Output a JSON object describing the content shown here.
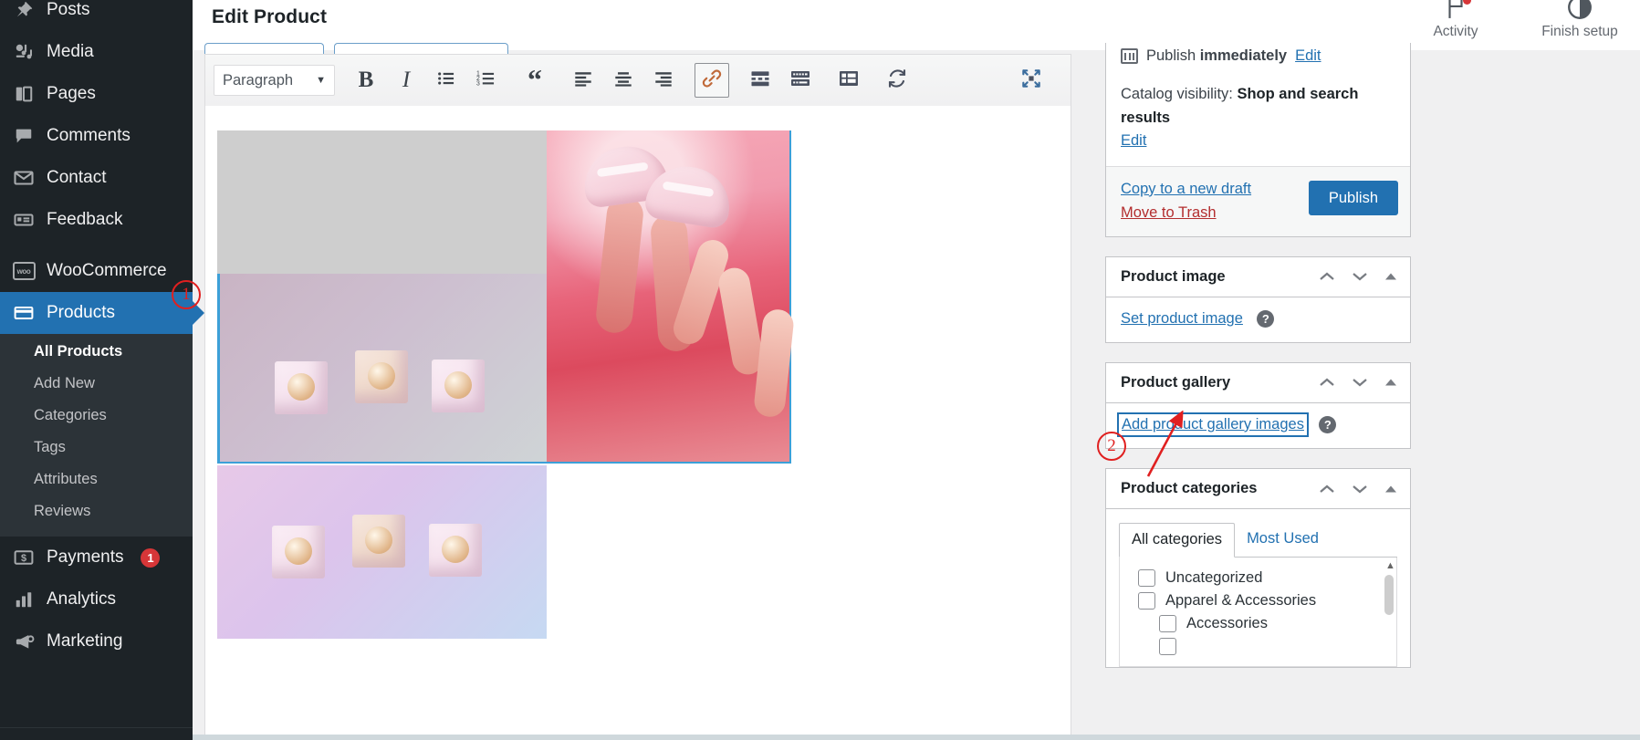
{
  "sidebar": {
    "items": [
      {
        "label": "Posts",
        "icon": "pin-icon",
        "active": false
      },
      {
        "label": "Media",
        "icon": "media-icon",
        "active": false
      },
      {
        "label": "Pages",
        "icon": "pages-icon",
        "active": false
      },
      {
        "label": "Comments",
        "icon": "comment-icon",
        "active": false
      },
      {
        "label": "Contact",
        "icon": "envelope-icon",
        "active": false
      },
      {
        "label": "Feedback",
        "icon": "feedback-icon",
        "active": false
      },
      {
        "label": "WooCommerce",
        "icon": "woo-icon",
        "active": false
      },
      {
        "label": "Products",
        "icon": "products-icon",
        "active": true
      },
      {
        "label": "Payments",
        "icon": "payments-icon",
        "active": false,
        "badge": "1"
      },
      {
        "label": "Analytics",
        "icon": "analytics-icon",
        "active": false
      },
      {
        "label": "Marketing",
        "icon": "megaphone-icon",
        "active": false
      }
    ],
    "submenu": [
      {
        "label": "All Products",
        "current": true
      },
      {
        "label": "Add New",
        "current": false
      },
      {
        "label": "Categories",
        "current": false
      },
      {
        "label": "Tags",
        "current": false
      },
      {
        "label": "Attributes",
        "current": false
      },
      {
        "label": "Reviews",
        "current": false
      }
    ]
  },
  "header": {
    "title": "Edit Product",
    "actions": [
      {
        "label": "Activity",
        "icon": "flag-icon",
        "has_dot": true
      },
      {
        "label": "Finish setup",
        "icon": "progress-circle-icon",
        "has_dot": false
      }
    ]
  },
  "editor": {
    "format_select": {
      "value": "Paragraph",
      "caret": "▼"
    },
    "buttons": [
      {
        "name": "bold-button",
        "label": "B",
        "active": false
      },
      {
        "name": "italic-button",
        "label": "I",
        "active": false
      },
      {
        "name": "bulleted-list-button",
        "label": "Bulleted list",
        "active": false
      },
      {
        "name": "numbered-list-button",
        "label": "Numbered list",
        "active": false
      },
      {
        "name": "blockquote-button",
        "label": "Blockquote",
        "active": false
      },
      {
        "name": "align-left-button",
        "label": "Align left",
        "active": false
      },
      {
        "name": "align-center-button",
        "label": "Align center",
        "active": false
      },
      {
        "name": "align-right-button",
        "label": "Align right",
        "active": false
      },
      {
        "name": "insert-link-button",
        "label": "Insert/edit link",
        "active": true
      },
      {
        "name": "read-more-button",
        "label": "Insert Read More tag",
        "active": false
      },
      {
        "name": "keyboard-shortcuts-button",
        "label": "Keyboard shortcuts",
        "active": false
      },
      {
        "name": "toolbar-toggle-button",
        "label": "Toolbar toggle",
        "active": false
      },
      {
        "name": "undo-redo-button",
        "label": "Redo",
        "active": false
      }
    ],
    "fullscreen_label": "Distraction-free writing mode"
  },
  "publish_box": {
    "schedule_text_prefix": "Publish ",
    "schedule_text_strong": "immediately",
    "schedule_edit": "Edit",
    "catalog_label": "Catalog visibility: ",
    "catalog_value": "Shop and search results",
    "catalog_edit": "Edit",
    "copy_draft": "Copy to a new draft",
    "move_trash": "Move to Trash",
    "publish_button": "Publish"
  },
  "product_image": {
    "title": "Product image",
    "link": "Set product image",
    "help": "?"
  },
  "product_gallery": {
    "title": "Product gallery",
    "link": "Add product gallery images",
    "help": "?",
    "focused": true
  },
  "product_categories": {
    "title": "Product categories",
    "tabs": [
      {
        "label": "All categories",
        "active": true
      },
      {
        "label": "Most Used",
        "active": false
      }
    ],
    "items": [
      {
        "label": "Uncategorized",
        "checked": false,
        "indent": 0
      },
      {
        "label": "Apparel & Accessories",
        "checked": false,
        "indent": 0
      },
      {
        "label": "Accessories",
        "checked": false,
        "indent": 1
      }
    ]
  },
  "annotations": [
    {
      "id": "1",
      "label": "1"
    },
    {
      "id": "2",
      "label": "2"
    }
  ],
  "colors": {
    "accent": "#2271b1",
    "sidebar_bg": "#1d2327",
    "submenu_bg": "#2c3338",
    "danger": "#b32d2e",
    "badge": "#d63638",
    "annotation": "#e02020"
  }
}
